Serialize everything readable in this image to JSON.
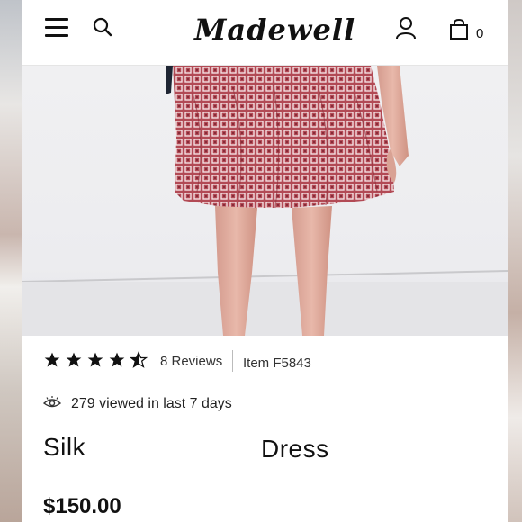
{
  "header": {
    "logo": "Madewell",
    "bag_count": "0",
    "icons": [
      "menu-icon",
      "search-icon",
      "account-icon",
      "shopping-bag-icon"
    ]
  },
  "product": {
    "rating_stars": 4.5,
    "reviews_label": "8 Reviews",
    "item_label": "Item F5843",
    "viewed_text": "279 viewed in last 7 days",
    "title_word_1": "Silk",
    "title_word_2": "Dress",
    "price": "$150.00"
  },
  "colors": {
    "skirt": "#b24a55",
    "text": "#111111"
  }
}
